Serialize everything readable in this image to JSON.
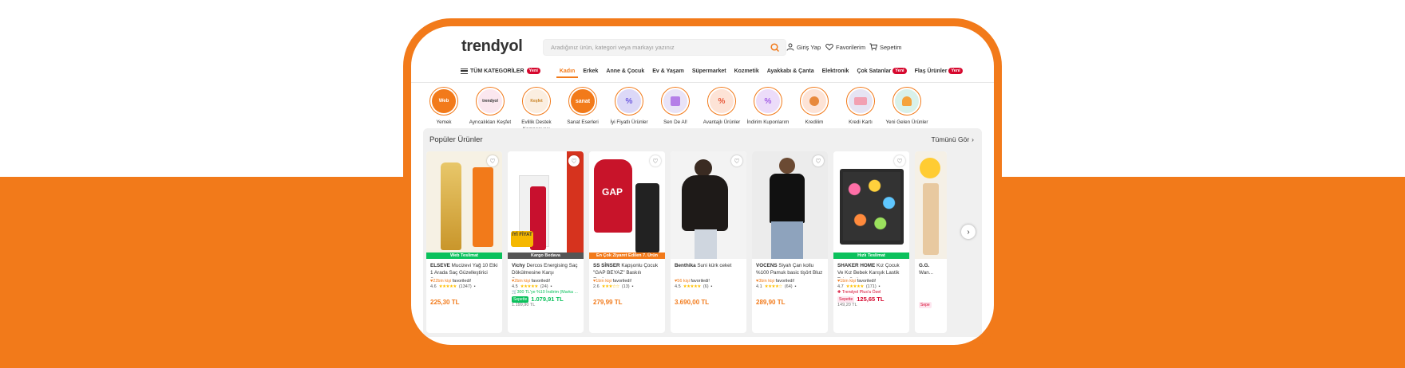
{
  "header": {
    "logo": "trendyol",
    "search_placeholder": "Aradığınız ürün, kategori veya markayı yazınız",
    "login": "Giriş Yap",
    "favorites": "Favorilerim",
    "cart": "Sepetim"
  },
  "nav": {
    "all_categories": "TÜM KATEGORİLER",
    "new_badge": "Yeni",
    "items": [
      "Kadın",
      "Erkek",
      "Anne & Çocuk",
      "Ev & Yaşam",
      "Süpermarket",
      "Kozmetik",
      "Ayakkabı & Çanta",
      "Elektronik",
      "Çok Satanlar",
      "Flaş Ürünler"
    ]
  },
  "stories": [
    {
      "label": "Yemek",
      "icon_text": "Web"
    },
    {
      "label": "Ayrıcalıkları Keşfet",
      "icon_text": "trendyol"
    },
    {
      "label": "Evlilik Destek\nKampanyası",
      "icon_text": "Keşfet"
    },
    {
      "label": "Sanat Eserleri",
      "icon_text": "sanat"
    },
    {
      "label": "İyi Fiyatlı Ürünler",
      "icon_text": "%"
    },
    {
      "label": "Sen De Al!",
      "icon_text": ""
    },
    {
      "label": "Avantajlı Ürünler",
      "icon_text": "%"
    },
    {
      "label": "İndirim Kuponlarım",
      "icon_text": "%"
    },
    {
      "label": "Kredilim",
      "icon_text": ""
    },
    {
      "label": "Kredi Kartı",
      "icon_text": ""
    },
    {
      "label": "Yeni Gelen Ürünler",
      "icon_text": ""
    }
  ],
  "popular": {
    "title": "Popüler Ürünler",
    "see_all": "Tümünü Gör",
    "products": [
      {
        "brand": "ELSEVE",
        "name": "Mucizevi Yağ 10 Etki 1 Arada Saç Güzelleştirici Sprey...",
        "fav": "22bin kişi",
        "fav_suffix": "favoriledi!",
        "rating": "4.6",
        "count": "(1347)",
        "strip": "Web Teslimat",
        "price": "225,30 TL",
        "promo": "",
        "price2_tag": "",
        "price2": "",
        "old": ""
      },
      {
        "brand": "Vichy",
        "name": "Dercos Energising Saç Dökülmesine Karşı Şampuan,...",
        "fav": "2bin kişi",
        "fav_suffix": "favoriledi!",
        "rating": "4.5",
        "count": "(24)",
        "strip": "Kargo Bedava",
        "price": "",
        "promo": "300 TL'ye %10 İndirim (Marka ...",
        "price2_tag": "Sepette",
        "price2": "1.079,91 TL",
        "old": "1.199,90 TL"
      },
      {
        "brand": "SS SİNSER",
        "name": "Kapşonlu Çocuk \"GAP BEYAZ\" Baskılı Eşofman...",
        "fav": "1bin kişi",
        "fav_suffix": "favoriledi!",
        "rating": "2.6",
        "count": "(13)",
        "strip": "En Çok Ziyaret Edilen 7. Ürün",
        "price": "279,99 TL",
        "promo": "",
        "price2_tag": "",
        "price2": "",
        "old": ""
      },
      {
        "brand": "Benthika",
        "name": "Suni kürk ceket",
        "fav": "56 kişi",
        "fav_suffix": "favoriledi!",
        "rating": "4.5",
        "count": "(6)",
        "strip": "",
        "price": "3.690,00 TL",
        "promo": "",
        "price2_tag": "",
        "price2": "",
        "old": ""
      },
      {
        "brand": "VOCENS",
        "name": "Siyah Çan kollu %100 Pamuk basic tişört Bluz",
        "fav": "3bin kişi",
        "fav_suffix": "favoriledi!",
        "rating": "4.1",
        "count": "(64)",
        "strip": "",
        "price": "289,90 TL",
        "promo": "",
        "price2_tag": "",
        "price2": "",
        "old": ""
      },
      {
        "brand": "SHAKER HOME",
        "name": "Kız Çocuk Ve Kız Bebek Karışık Lastik Toka Seti...",
        "fav": "1bin kişi",
        "fav_suffix": "favoriledi!",
        "rating": "4.7",
        "count": "(171)",
        "strip": "Hızlı Teslimat",
        "price": "",
        "promo": "Trendyol Plus'a Özel",
        "price2_tag": "Sepette",
        "price2": "125,65 TL",
        "old": "149,20 TL"
      },
      {
        "brand": "G.G.",
        "name": "Wan...",
        "fav": "",
        "fav_suffix": "",
        "rating": "",
        "count": "",
        "strip": "",
        "price": "",
        "promo": "",
        "price2_tag": "Sepe",
        "price2": "",
        "old": ""
      }
    ]
  },
  "colors": {
    "accent": "#f27a1a",
    "green": "#0bc15c",
    "red": "#d6082e"
  }
}
